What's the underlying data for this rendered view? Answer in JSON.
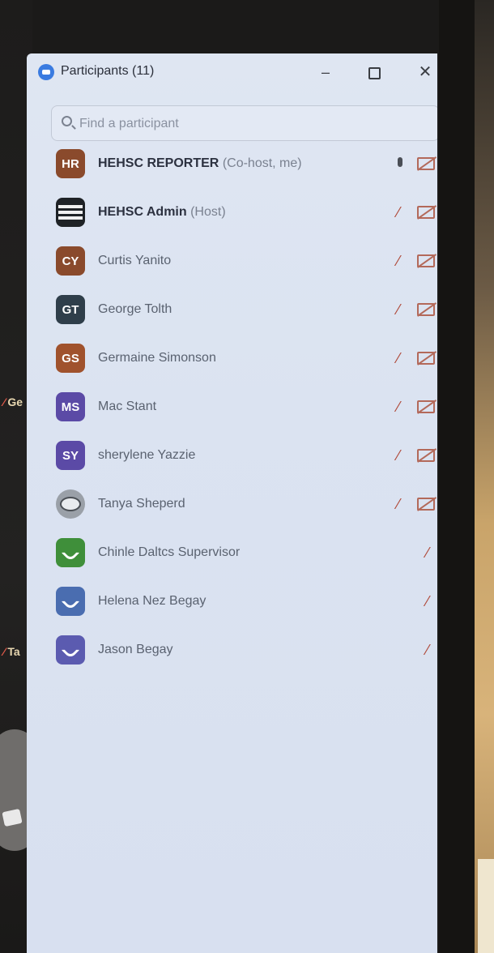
{
  "background": {
    "left_labels": [
      {
        "text": "Ge"
      },
      {
        "text": "Ta"
      }
    ]
  },
  "window": {
    "title": "Participants (11)",
    "minimize_label": "–",
    "close_label": "✕"
  },
  "search": {
    "placeholder": "Find a participant"
  },
  "participants": [
    {
      "initials": "HR",
      "name": "HEHSC REPORTER",
      "role": "(Co-host, me)",
      "avatar_type": "initials",
      "color": "#8a4a2c",
      "bold": true
    },
    {
      "initials": "",
      "name": "HEHSC Admin",
      "role": "(Host)",
      "avatar_type": "logo",
      "color": "#1e2226",
      "bold": true
    },
    {
      "initials": "CY",
      "name": "Curtis Yanito",
      "role": "",
      "avatar_type": "initials",
      "color": "#8a4a2c",
      "bold": false
    },
    {
      "initials": "GT",
      "name": "George Tolth",
      "role": "",
      "avatar_type": "initials",
      "color": "#2f3e4a",
      "bold": false
    },
    {
      "initials": "GS",
      "name": "Germaine Simonson",
      "role": "",
      "avatar_type": "initials",
      "color": "#a0522d",
      "bold": false
    },
    {
      "initials": "MS",
      "name": "Mac Stant",
      "role": "",
      "avatar_type": "initials",
      "color": "#5b4aa6",
      "bold": false
    },
    {
      "initials": "SY",
      "name": "sherylene Yazzie",
      "role": "",
      "avatar_type": "initials",
      "color": "#5b4aa6",
      "bold": false
    },
    {
      "initials": "",
      "name": "Tanya Sheperd",
      "role": "",
      "avatar_type": "photo",
      "color": "#9aa0a8",
      "bold": false
    },
    {
      "initials": "",
      "name": "Chinle Daltcs Supervisor",
      "role": "",
      "avatar_type": "phone",
      "color": "#3f8f3a",
      "bold": false
    },
    {
      "initials": "",
      "name": "Helena Nez Begay",
      "role": "",
      "avatar_type": "phone",
      "color": "#4a6db0",
      "bold": false
    },
    {
      "initials": "",
      "name": "Jason Begay",
      "role": "",
      "avatar_type": "phone",
      "color": "#5b5bb0",
      "bold": false
    }
  ],
  "icons": {
    "muted_mic": "mic-muted-icon",
    "live_mic": "mic-icon",
    "video_off": "video-off-icon"
  }
}
